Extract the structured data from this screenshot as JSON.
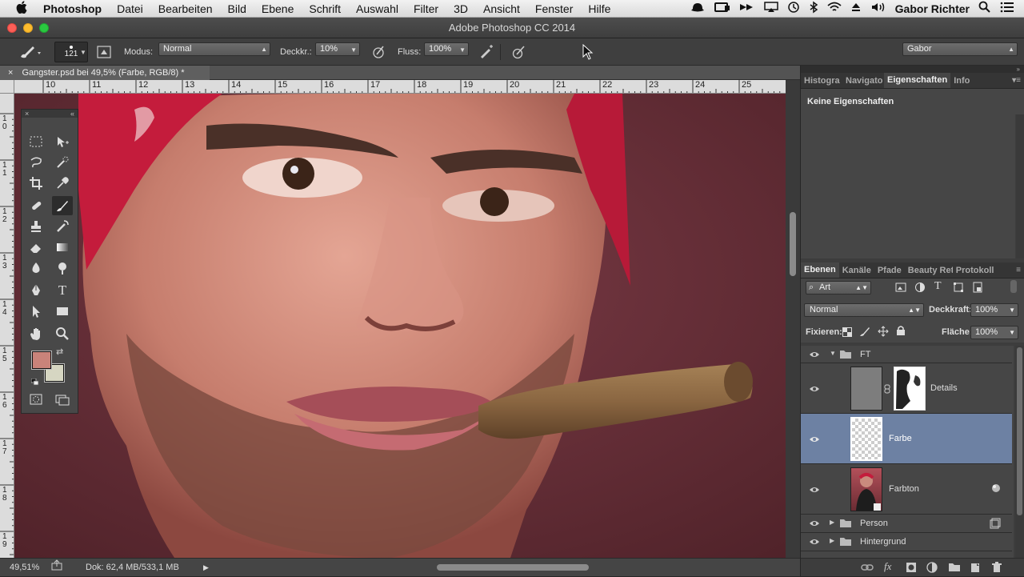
{
  "menubar": {
    "apple": "",
    "app": "Photoshop",
    "items": [
      "Datei",
      "Bearbeiten",
      "Bild",
      "Ebene",
      "Schrift",
      "Auswahl",
      "Filter",
      "3D",
      "Ansicht",
      "Fenster",
      "Hilfe"
    ],
    "user": "Gabor Richter"
  },
  "window": {
    "title": "Adobe Photoshop CC 2014"
  },
  "options": {
    "brush_size": "121",
    "mode_label": "Modus:",
    "mode_value": "Normal",
    "opacity_label": "Deckkr.:",
    "opacity_value": "10%",
    "flow_label": "Fluss:",
    "flow_value": "100%",
    "workspace": "Gabor"
  },
  "document": {
    "tab_title": "Gangster.psd bei 49,5% (Farbe, RGB/8) *",
    "close": "×"
  },
  "ruler": {
    "h_ticks": [
      "10",
      "11",
      "12",
      "13",
      "14",
      "15",
      "16",
      "17",
      "18",
      "19",
      "20",
      "21",
      "22",
      "23",
      "24",
      "25"
    ],
    "v_ticks": [
      "1\n0",
      "1\n1",
      "1\n2",
      "1\n3",
      "1\n4",
      "1\n5",
      "1\n6",
      "1\n7",
      "1\n8",
      "1\n9"
    ]
  },
  "status": {
    "zoom": "49,51%",
    "doc": "Dok: 62,4 MB/533,1 MB"
  },
  "top_panel": {
    "tabs": [
      "Histogra",
      "Navigato",
      "Eigenschaften",
      "Info"
    ],
    "active": "Eigenschaften",
    "message": "Keine Eigenschaften"
  },
  "layers_panel": {
    "tabs": [
      "Ebenen",
      "Kanäle",
      "Pfade",
      "Beauty Ret",
      "Protokoll"
    ],
    "filter_label": "Art",
    "blend_mode": "Normal",
    "opacity_label": "Deckkraft:",
    "opacity_value": "100%",
    "lock_label": "Fixieren:",
    "fill_label": "Fläche:",
    "fill_value": "100%",
    "layers": [
      {
        "name": "FT",
        "type": "group",
        "expanded": true
      },
      {
        "name": "Details",
        "type": "layer-with-mask"
      },
      {
        "name": "Farbe",
        "type": "layer",
        "selected": true
      },
      {
        "name": "Farbton",
        "type": "smart-object"
      },
      {
        "name": "Person",
        "type": "group",
        "expanded": false
      },
      {
        "name": "Hintergrund",
        "type": "group",
        "expanded": false
      }
    ]
  },
  "colors": {
    "foreground": "#c9837a",
    "background": "#d6d6c2",
    "selected_layer": "#6d81a3",
    "canvas_bg": "#612c35"
  }
}
